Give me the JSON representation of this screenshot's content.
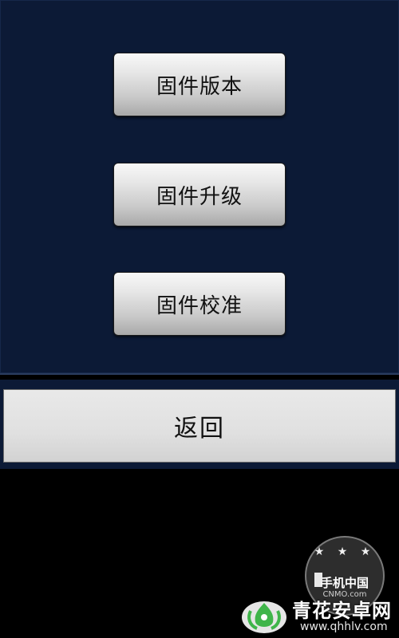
{
  "menu": {
    "items": [
      {
        "label": "固件版本"
      },
      {
        "label": "固件升级"
      },
      {
        "label": "固件校准"
      }
    ]
  },
  "footer": {
    "back_label": "返回"
  },
  "watermarks": {
    "cnmo_stars": "★ ★ ★",
    "cnmo_name": "手机中国",
    "cnmo_sub": "CNMO.com",
    "site_name": "青花安卓网",
    "site_url": "www.qhhlv.com"
  },
  "colors": {
    "panel_background": "#0c1a36",
    "button_face": "#d9d9d9",
    "page_background": "#000000",
    "logo_green": "#3fb54a"
  }
}
